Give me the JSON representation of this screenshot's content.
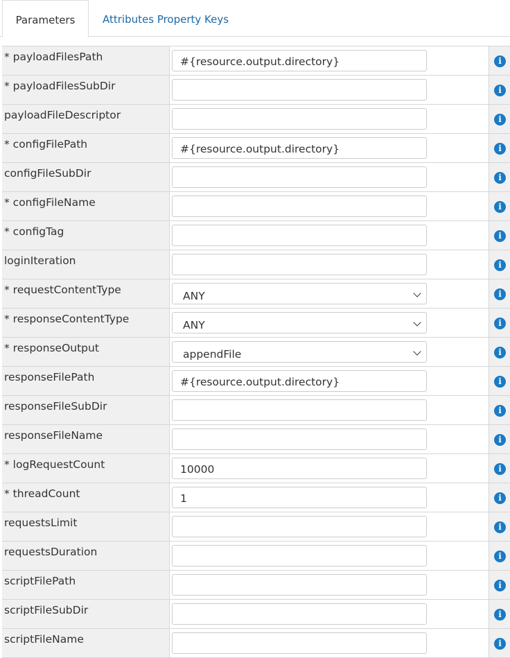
{
  "tabs": [
    {
      "label": "Parameters",
      "active": true
    },
    {
      "label": "Attributes Property Keys",
      "active": false
    }
  ],
  "info_icon": "info-icon",
  "colors": {
    "link": "#1a6aa8",
    "info_icon_bg": "#1a7ac4",
    "label_bg": "#f0f0f0"
  },
  "parameters": [
    {
      "label": "* payloadFilesPath",
      "value": "#{resource.output.directory}",
      "type": "text"
    },
    {
      "label": "* payloadFilesSubDir",
      "value": "",
      "type": "text"
    },
    {
      "label": "payloadFileDescriptor",
      "value": "",
      "type": "text"
    },
    {
      "label": "* configFilePath",
      "value": "#{resource.output.directory}",
      "type": "text"
    },
    {
      "label": "configFileSubDir",
      "value": "",
      "type": "text"
    },
    {
      "label": "* configFileName",
      "value": "",
      "type": "text"
    },
    {
      "label": "* configTag",
      "value": "",
      "type": "text"
    },
    {
      "label": "loginIteration",
      "value": "",
      "type": "text"
    },
    {
      "label": "* requestContentType",
      "value": "ANY",
      "type": "select"
    },
    {
      "label": "* responseContentType",
      "value": "ANY",
      "type": "select"
    },
    {
      "label": "* responseOutput",
      "value": "appendFile",
      "type": "select"
    },
    {
      "label": "responseFilePath",
      "value": "#{resource.output.directory}",
      "type": "text"
    },
    {
      "label": "responseFileSubDir",
      "value": "",
      "type": "text"
    },
    {
      "label": "responseFileName",
      "value": "",
      "type": "text"
    },
    {
      "label": "* logRequestCount",
      "value": "10000",
      "type": "text"
    },
    {
      "label": "* threadCount",
      "value": "1",
      "type": "text"
    },
    {
      "label": "requestsLimit",
      "value": "",
      "type": "text"
    },
    {
      "label": "requestsDuration",
      "value": "",
      "type": "text"
    },
    {
      "label": "scriptFilePath",
      "value": "",
      "type": "text"
    },
    {
      "label": "scriptFileSubDir",
      "value": "",
      "type": "text"
    },
    {
      "label": "scriptFileName",
      "value": "",
      "type": "text"
    }
  ]
}
